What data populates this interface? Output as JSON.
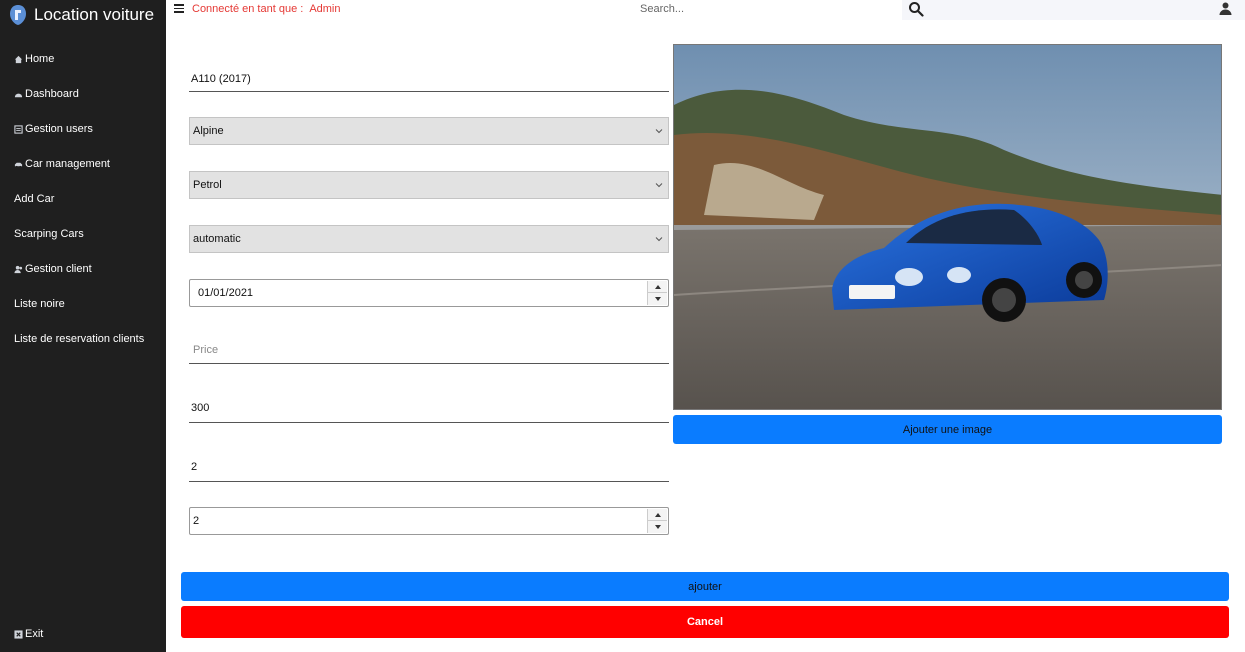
{
  "app": {
    "title": "Location voiture"
  },
  "sidebar": {
    "items": [
      {
        "label": "Home",
        "icon": "home-icon"
      },
      {
        "label": "Dashboard",
        "icon": "dashboard-icon"
      },
      {
        "label": "Gestion users",
        "icon": "list-icon"
      },
      {
        "label": "Car management",
        "icon": "car-icon"
      },
      {
        "label": "Add Car",
        "icon": ""
      },
      {
        "label": "Scarping Cars",
        "icon": ""
      },
      {
        "label": "Gestion client",
        "icon": "users-icon"
      },
      {
        "label": "Liste noire",
        "icon": ""
      },
      {
        "label": "Liste de reservation clients",
        "icon": ""
      }
    ],
    "exit_label": "Exit"
  },
  "topbar": {
    "connected_label": "Connecté en tant que :",
    "user": "Admin",
    "search_placeholder": "Search..."
  },
  "form": {
    "model": "A110 (2017)",
    "brand": "Alpine",
    "fuel": "Petrol",
    "transmission": "automatic",
    "date": "01/01/2021",
    "price_placeholder": "Price",
    "value1": "300",
    "value2": "2",
    "value3": "2"
  },
  "buttons": {
    "add_image": "Ajouter une image",
    "submit": "ajouter",
    "cancel": "Cancel"
  },
  "colors": {
    "primary": "#0a7cff",
    "danger": "#ff0000",
    "sidebar": "#1f1f1f",
    "connected": "#e53935"
  }
}
